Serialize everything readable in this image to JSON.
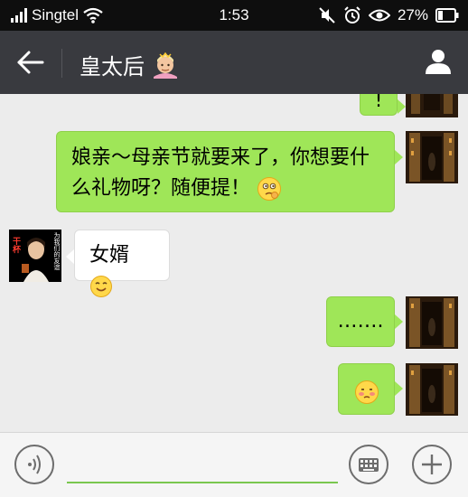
{
  "status_bar": {
    "carrier": "Singtel",
    "time": "1:53",
    "battery": "27%",
    "icons": [
      "signal-icon",
      "wifi-icon",
      "mute-icon",
      "alarm-icon",
      "eye-icon",
      "battery-icon"
    ]
  },
  "header": {
    "title": "皇太后",
    "title_emoji": "emoji-person-crown-icon",
    "back_icon": "back-arrow-icon",
    "profile_icon": "person-icon",
    "bar_color": "#393a3f"
  },
  "messages": [
    {
      "from": "me",
      "text": "!"
    },
    {
      "from": "me",
      "text": "娘亲～母亲节就要来了，你想要什么礼物呀？随便提！",
      "emoji": "thinking-emoji-icon"
    },
    {
      "from": "other",
      "text": "女婿",
      "emoji": "smile-emoji-icon"
    },
    {
      "from": "me",
      "text": "……."
    },
    {
      "from": "me",
      "text": "",
      "emoji": "blush-emoji-icon"
    }
  ],
  "other_avatar": {
    "badge": "干杯",
    "caption": "为我们的友谊"
  },
  "input_bar": {
    "value": "",
    "voice_icon": "voice-icon",
    "keyboard_icon": "keyboard-icon",
    "plus_icon": "plus-icon"
  },
  "colors": {
    "bubble_mine": "#9fe658",
    "bubble_other": "#ffffff",
    "background": "#ececec"
  }
}
